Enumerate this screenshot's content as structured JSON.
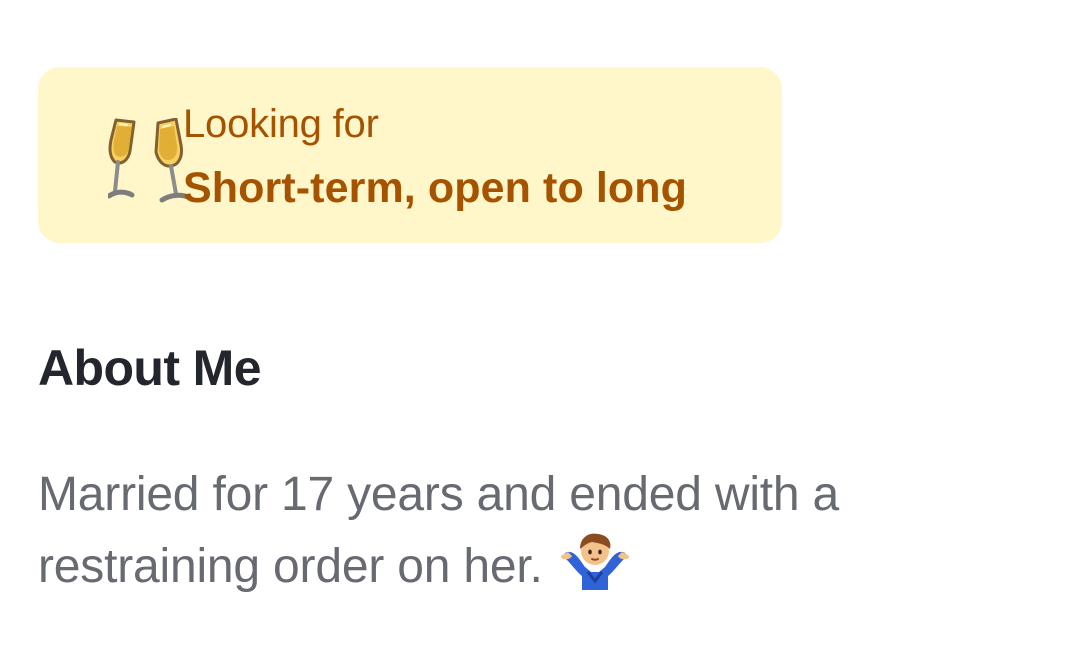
{
  "looking_for": {
    "label": "Looking for",
    "value": "Short-term, open to long",
    "icon": "champagne-glasses-icon",
    "background": "#fff7c9",
    "text_color": "#a65300"
  },
  "about": {
    "title": "About Me",
    "text": "Married for 17 years and ended with a restraining order on her.",
    "emoji": "person-shrugging-icon"
  }
}
